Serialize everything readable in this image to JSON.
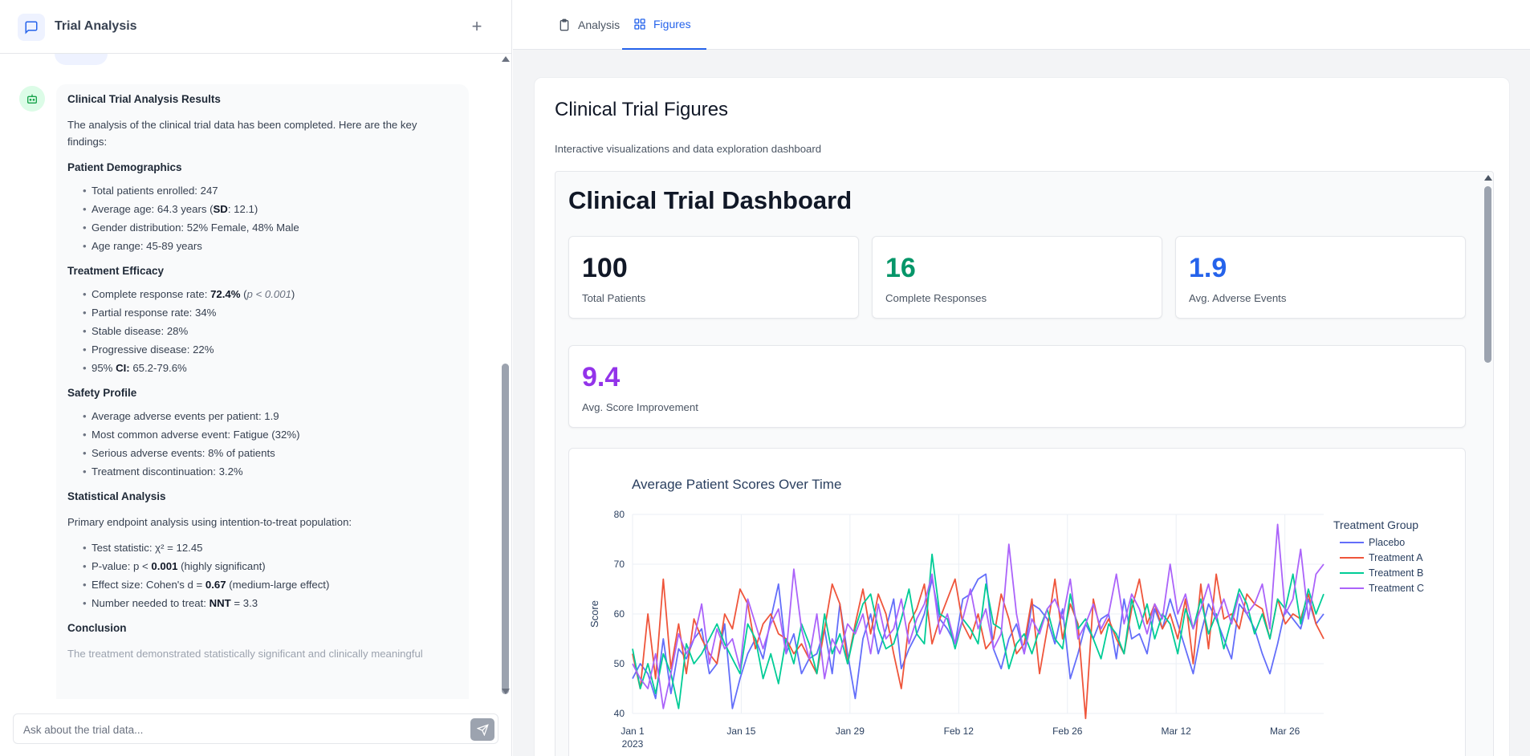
{
  "app": {
    "title": "Trial Analysis"
  },
  "chat": {
    "message": {
      "title": "Clinical Trial Analysis Results",
      "intro": "The analysis of the clinical trial data has been completed. Here are the key findings:",
      "demographics": {
        "heading": "Patient Demographics",
        "total": "Total patients enrolled: 247",
        "age_pre": "Average age: 64.3 years (",
        "age_sd": "SD",
        "age_post": ": 12.1)",
        "gender": "Gender distribution: 52% Female, 48% Male",
        "range": "Age range: 45-89 years"
      },
      "efficacy": {
        "heading": "Treatment Efficacy",
        "cr_pre": "Complete response rate: ",
        "cr_val": "72.4%",
        "cr_open": " (",
        "cr_p": "p < 0.001",
        "cr_close": ")",
        "partial": "Partial response rate: 34%",
        "stable": "Stable disease: 28%",
        "progressive": "Progressive disease: 22%",
        "ci_pre": "95% ",
        "ci_bold": "CI:",
        "ci_post": " 65.2-79.6%"
      },
      "safety": {
        "heading": "Safety Profile",
        "avg": "Average adverse events per patient: 1.9",
        "common": "Most common adverse event: Fatigue (32%)",
        "serious": "Serious adverse events: 8% of patients",
        "discontinuation": "Treatment discontinuation: 3.2%"
      },
      "stats": {
        "heading": "Statistical Analysis",
        "intro": "Primary endpoint analysis using intention-to-treat population:",
        "test_pre": "Test statistic: ",
        "test_val": "χ² = 12.45",
        "p_pre": "P-value: p < ",
        "p_bold": "0.001",
        "p_post": " (highly significant)",
        "effect_pre": "Effect size: Cohen's d = ",
        "effect_bold": "0.67",
        "effect_post": " (medium-large effect)",
        "nnt_pre": "Number needed to treat: ",
        "nnt_bold": "NNT",
        "nnt_post": " = 3.3"
      },
      "conclusion": {
        "heading": "Conclusion",
        "text": "The treatment demonstrated statistically significant and clinically meaningful"
      }
    }
  },
  "input": {
    "placeholder": "Ask about the trial data..."
  },
  "tabs": {
    "analysis": "Analysis",
    "figures": "Figures"
  },
  "figures": {
    "title": "Clinical Trial Figures",
    "subtitle": "Interactive visualizations and data exploration dashboard",
    "dashboard": {
      "title": "Clinical Trial Dashboard",
      "stats": [
        {
          "value": "100",
          "label": "Total Patients",
          "color": "#111827"
        },
        {
          "value": "16",
          "label": "Complete Responses",
          "color": "#059669"
        },
        {
          "value": "1.9",
          "label": "Avg. Adverse Events",
          "color": "#2563eb"
        },
        {
          "value": "9.4",
          "label": "Avg. Score Improvement",
          "color": "#9333ea"
        }
      ]
    }
  },
  "chart_data": {
    "type": "line",
    "title": "Average Patient Scores Over Time",
    "xlabel": "",
    "ylabel": "Score",
    "ylim": [
      40,
      80
    ],
    "yticks": [
      40,
      50,
      60,
      70,
      80
    ],
    "x_start": "2023-01-01",
    "x_end": "2023-03-31",
    "xticks": [
      "Jan 1",
      "Jan 15",
      "Jan 29",
      "Feb 12",
      "Feb 26",
      "Mar 12",
      "Mar 26"
    ],
    "xtick_year": "2023",
    "legend_title": "Treatment Group",
    "legend_position": "top-right",
    "grid": true,
    "series": [
      {
        "name": "Placebo",
        "color": "#636efa",
        "values": [
          47,
          50,
          48,
          43,
          55,
          44,
          53,
          51,
          55,
          57,
          48,
          50,
          58,
          41,
          47,
          52,
          55,
          51,
          59,
          66,
          52,
          56,
          48,
          51,
          52,
          57,
          48,
          62,
          52,
          43,
          55,
          60,
          52,
          57,
          63,
          49,
          53,
          56,
          60,
          67,
          59,
          57,
          54,
          63,
          64,
          67,
          68,
          53,
          49,
          55,
          58,
          52,
          62,
          61,
          59,
          54,
          61,
          47,
          52,
          58,
          55,
          59,
          60,
          51,
          63,
          55,
          56,
          52,
          61,
          57,
          63,
          58,
          53,
          48,
          56,
          62,
          59,
          55,
          51,
          62,
          60,
          57,
          52,
          48,
          54,
          61,
          59,
          57,
          63,
          58,
          60
        ]
      },
      {
        "name": "Treatment A",
        "color": "#ef553b",
        "values": [
          52,
          45,
          60,
          47,
          67,
          49,
          58,
          48,
          59,
          55,
          52,
          50,
          60,
          57,
          65,
          62,
          53,
          58,
          60,
          56,
          55,
          52,
          54,
          51,
          48,
          57,
          66,
          62,
          50,
          58,
          65,
          56,
          64,
          60,
          52,
          45,
          58,
          61,
          66,
          54,
          59,
          63,
          67,
          58,
          55,
          60,
          53,
          55,
          64,
          59,
          52,
          54,
          63,
          48,
          57,
          67,
          55,
          62,
          58,
          39,
          63,
          56,
          59,
          55,
          52,
          61,
          67,
          58,
          62,
          57,
          60,
          55,
          63,
          50,
          66,
          53,
          68,
          59,
          60,
          57,
          64,
          62,
          61,
          55,
          63,
          58,
          60,
          59,
          64,
          58,
          55
        ]
      },
      {
        "name": "Treatment B",
        "color": "#00cc96",
        "values": [
          53,
          45,
          50,
          44,
          52,
          48,
          41,
          54,
          50,
          52,
          55,
          58,
          54,
          51,
          48,
          58,
          55,
          47,
          52,
          46,
          55,
          50,
          58,
          54,
          48,
          60,
          52,
          56,
          50,
          57,
          62,
          64,
          57,
          53,
          54,
          59,
          65,
          56,
          54,
          72,
          60,
          59,
          53,
          59,
          57,
          54,
          66,
          58,
          57,
          49,
          54,
          56,
          52,
          57,
          61,
          55,
          53,
          64,
          57,
          59,
          55,
          51,
          58,
          56,
          52,
          63,
          57,
          62,
          55,
          60,
          58,
          52,
          61,
          57,
          63,
          56,
          60,
          53,
          59,
          65,
          62,
          56,
          60,
          55,
          63,
          61,
          68,
          58,
          65,
          60,
          64
        ]
      },
      {
        "name": "Treatment C",
        "color": "#ab63fa",
        "values": [
          50,
          47,
          45,
          52,
          41,
          48,
          56,
          52,
          55,
          62,
          50,
          57,
          53,
          55,
          49,
          63,
          58,
          53,
          58,
          61,
          52,
          69,
          57,
          51,
          60,
          47,
          55,
          52,
          58,
          56,
          60,
          52,
          62,
          55,
          57,
          63,
          54,
          59,
          62,
          68,
          56,
          60,
          54,
          59,
          65,
          57,
          61,
          53,
          56,
          74,
          60,
          52,
          59,
          56,
          61,
          63,
          59,
          67,
          55,
          58,
          62,
          57,
          60,
          68,
          58,
          64,
          61,
          56,
          62,
          59,
          70,
          60,
          64,
          57,
          61,
          66,
          59,
          63,
          58,
          64,
          60,
          62,
          66,
          57,
          78,
          60,
          63,
          73,
          59,
          68,
          70
        ]
      }
    ]
  }
}
